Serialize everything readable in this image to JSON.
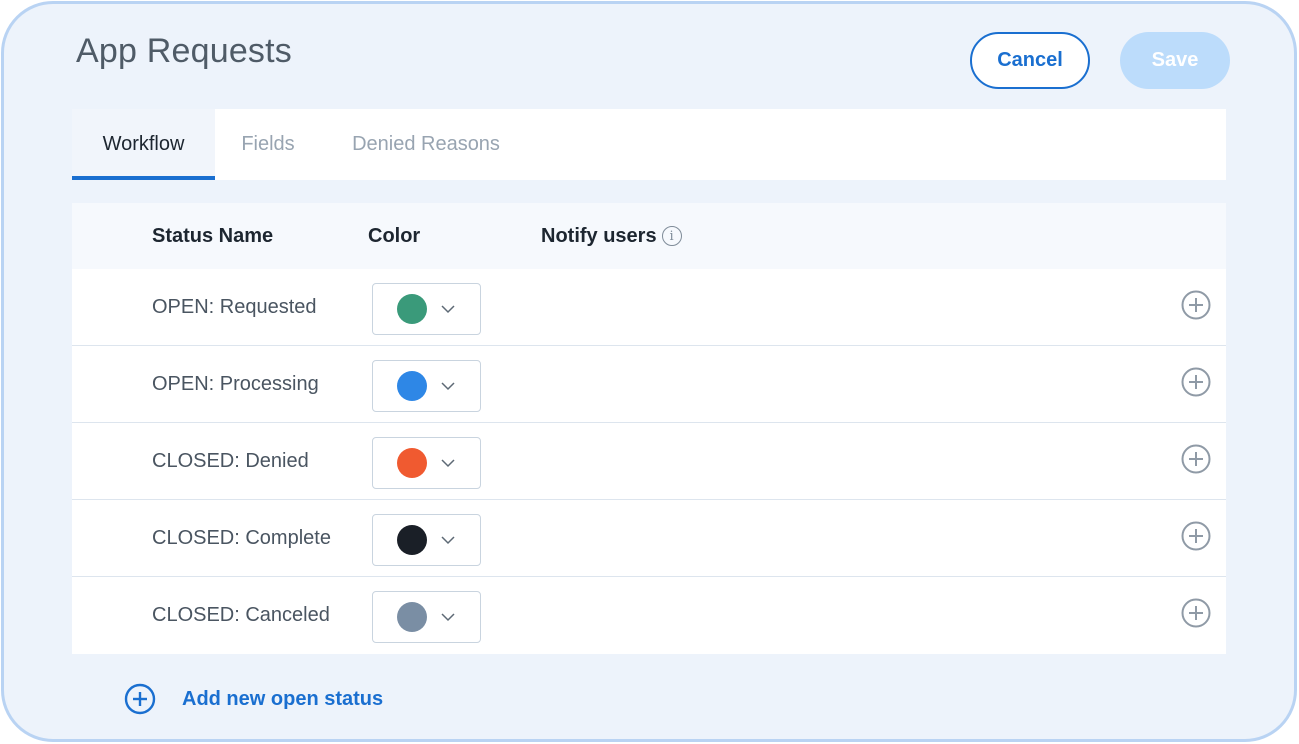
{
  "header": {
    "title": "App Requests",
    "cancel_label": "Cancel",
    "save_label": "Save"
  },
  "tabs": [
    {
      "label": "Workflow",
      "active": true
    },
    {
      "label": "Fields",
      "active": false
    },
    {
      "label": "Denied Reasons",
      "active": false
    }
  ],
  "table": {
    "columns": {
      "status_name": "Status Name",
      "color": "Color",
      "notify_users": "Notify users"
    },
    "rows": [
      {
        "name": "OPEN: Requested",
        "color": "#3a9a7a"
      },
      {
        "name": "OPEN: Processing",
        "color": "#2e87e6"
      },
      {
        "name": "CLOSED: Denied",
        "color": "#f05a30"
      },
      {
        "name": "CLOSED: Complete",
        "color": "#1a1f27"
      },
      {
        "name": "CLOSED: Canceled",
        "color": "#7a8ea4"
      }
    ]
  },
  "footer": {
    "add_status_label": "Add new open status"
  },
  "icons": {
    "info": "info-icon",
    "chevron": "chevron-down-icon",
    "add": "plus-circle-icon"
  },
  "theme": {
    "accent": "#1a6fd0",
    "save_disabled": "#bcdcfb",
    "frame_border": "#b9d3f3"
  }
}
